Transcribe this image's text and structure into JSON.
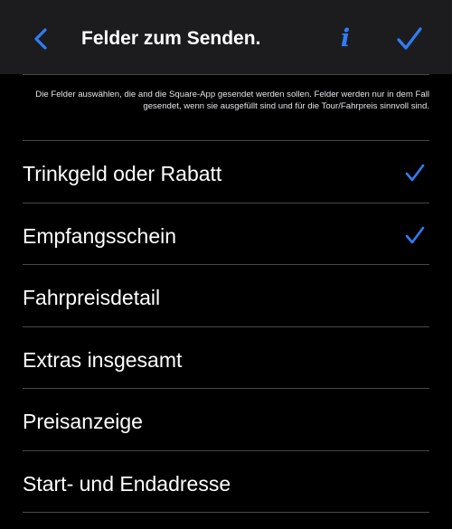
{
  "colors": {
    "background": "#000000",
    "navbar": "#1c1c1e",
    "accent": "#2f7df6",
    "separator": "#48484a",
    "text": "#ffffff"
  },
  "navbar": {
    "title": "Felder zum Senden.",
    "back_icon": "chevron-left-icon",
    "info_label": "i",
    "done_icon": "checkmark-icon"
  },
  "description": "Die Felder auswählen, die and die Square-App gesendet werden sollen. Felder werden nur in dem Fall gesendet, wenn sie ausgefüllt sind und für die Tour/Fahrpreis sinnvoll sind.",
  "fields": [
    {
      "label": "Trinkgeld oder Rabatt",
      "checked": true
    },
    {
      "label": "Empfangsschein",
      "checked": true
    },
    {
      "label": "Fahrpreisdetail",
      "checked": false
    },
    {
      "label": "Extras insgesamt",
      "checked": false
    },
    {
      "label": "Preisanzeige",
      "checked": false
    },
    {
      "label": "Start- und Endadresse",
      "checked": false
    }
  ]
}
